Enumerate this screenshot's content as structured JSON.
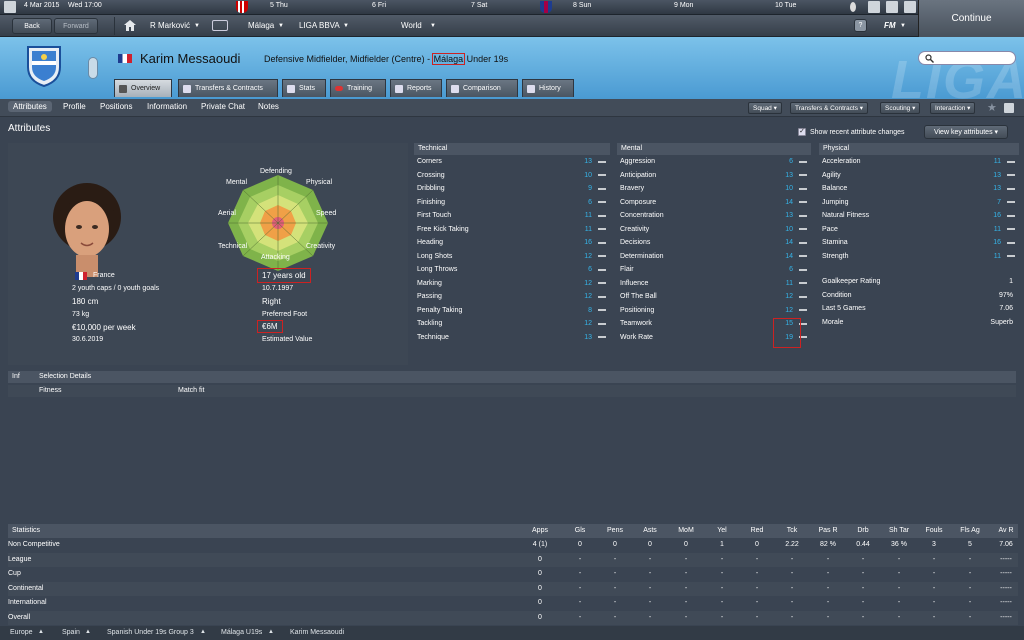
{
  "topbar": {
    "date": "4 Mar 2015",
    "daytime": "Wed 17:00",
    "calendar": [
      "5 Thu",
      "6 Fri",
      "7 Sat",
      "8 Sun",
      "9 Mon",
      "10 Tue"
    ]
  },
  "nav": {
    "back": "Back",
    "forward": "Forward",
    "manager": "R Marković",
    "club": "Málaga",
    "league": "LIGA BBVA",
    "world": "World",
    "help": "?",
    "fm": "FM",
    "continue": "Continue"
  },
  "player": {
    "name": "Karim Messaoudi",
    "description": "Defensive Midfielder, Midfielder (Centre) -",
    "club": "Málaga",
    "team": "Under 19s",
    "header_watermark": "LIGA"
  },
  "tabs": [
    "Overview",
    "Transfers & Contracts",
    "Stats",
    "Training",
    "Reports",
    "Comparison",
    "History"
  ],
  "subnav": [
    "Attributes",
    "Profile",
    "Positions",
    "Information",
    "Private Chat",
    "Notes"
  ],
  "dropdowns": [
    "Squad",
    "Transfers & Contracts",
    "Scouting",
    "Interaction"
  ],
  "section_title": "Attributes",
  "show_recent": "Show recent attribute changes",
  "view_key": "View key attributes",
  "radar": {
    "labels": [
      "Defending",
      "Physical",
      "Speed",
      "Creativity",
      "Attacking",
      "Technical",
      "Aerial",
      "Mental"
    ]
  },
  "profile": {
    "nationality": "France",
    "caps": "2 youth caps / 0 youth goals",
    "height": "180 cm",
    "weight": "73 kg",
    "wage": "€10,000 per week",
    "contract_end": "30.6.2019",
    "age": "17 years old",
    "dob": "10.7.1997",
    "foot": "Right",
    "foot_label": "Preferred Foot",
    "value": "€6M",
    "value_label": "Estimated Value"
  },
  "technical": {
    "title": "Technical",
    "attrs": [
      {
        "name": "Corners",
        "value": "13"
      },
      {
        "name": "Crossing",
        "value": "10"
      },
      {
        "name": "Dribbling",
        "value": "9"
      },
      {
        "name": "Finishing",
        "value": "6"
      },
      {
        "name": "First Touch",
        "value": "11"
      },
      {
        "name": "Free Kick Taking",
        "value": "11"
      },
      {
        "name": "Heading",
        "value": "16"
      },
      {
        "name": "Long Shots",
        "value": "12"
      },
      {
        "name": "Long Throws",
        "value": "6"
      },
      {
        "name": "Marking",
        "value": "12"
      },
      {
        "name": "Passing",
        "value": "12"
      },
      {
        "name": "Penalty Taking",
        "value": "8"
      },
      {
        "name": "Tackling",
        "value": "12"
      },
      {
        "name": "Technique",
        "value": "13"
      }
    ]
  },
  "mental": {
    "title": "Mental",
    "attrs": [
      {
        "name": "Aggression",
        "value": "6"
      },
      {
        "name": "Anticipation",
        "value": "13"
      },
      {
        "name": "Bravery",
        "value": "10"
      },
      {
        "name": "Composure",
        "value": "14"
      },
      {
        "name": "Concentration",
        "value": "13"
      },
      {
        "name": "Creativity",
        "value": "10"
      },
      {
        "name": "Decisions",
        "value": "14"
      },
      {
        "name": "Determination",
        "value": "14"
      },
      {
        "name": "Flair",
        "value": "6"
      },
      {
        "name": "Influence",
        "value": "11"
      },
      {
        "name": "Off The Ball",
        "value": "12"
      },
      {
        "name": "Positioning",
        "value": "12"
      },
      {
        "name": "Teamwork",
        "value": "15"
      },
      {
        "name": "Work Rate",
        "value": "19"
      }
    ]
  },
  "physical": {
    "title": "Physical",
    "attrs": [
      {
        "name": "Acceleration",
        "value": "11"
      },
      {
        "name": "Agility",
        "value": "13"
      },
      {
        "name": "Balance",
        "value": "13"
      },
      {
        "name": "Jumping",
        "value": "7"
      },
      {
        "name": "Natural Fitness",
        "value": "16"
      },
      {
        "name": "Pace",
        "value": "11"
      },
      {
        "name": "Stamina",
        "value": "16"
      },
      {
        "name": "Strength",
        "value": "11"
      }
    ],
    "extra": [
      {
        "name": "Goalkeeper Rating",
        "value": "1"
      },
      {
        "name": "Condition",
        "value": "97%"
      },
      {
        "name": "Last 5 Games",
        "value": "7.06"
      },
      {
        "name": "Morale",
        "value": "Superb"
      }
    ]
  },
  "selection": {
    "inf": "Inf",
    "title": "Selection Details",
    "fitness": "Fitness",
    "match_fit": "Match fit"
  },
  "stats": {
    "title": "Statistics",
    "columns": [
      "Apps",
      "Gls",
      "Pens",
      "Asts",
      "MoM",
      "Yel",
      "Red",
      "Tck",
      "Pas R",
      "Drb",
      "Sh Tar",
      "Fouls",
      "Fls Ag",
      "Av R"
    ],
    "rows": [
      {
        "label": "Non Competitive",
        "cells": [
          "4 (1)",
          "0",
          "0",
          "0",
          "0",
          "1",
          "0",
          "2.22",
          "82 %",
          "0.44",
          "36 %",
          "3",
          "5",
          "7.06"
        ]
      },
      {
        "label": "League",
        "cells": [
          "0",
          "-",
          "-",
          "-",
          "-",
          "-",
          "-",
          "-",
          "-",
          "-",
          "-",
          "-",
          "-",
          "-----"
        ]
      },
      {
        "label": "Cup",
        "cells": [
          "0",
          "-",
          "-",
          "-",
          "-",
          "-",
          "-",
          "-",
          "-",
          "-",
          "-",
          "-",
          "-",
          "-----"
        ]
      },
      {
        "label": "Continental",
        "cells": [
          "0",
          "-",
          "-",
          "-",
          "-",
          "-",
          "-",
          "-",
          "-",
          "-",
          "-",
          "-",
          "-",
          "-----"
        ]
      },
      {
        "label": "International",
        "cells": [
          "0",
          "-",
          "-",
          "-",
          "-",
          "-",
          "-",
          "-",
          "-",
          "-",
          "-",
          "-",
          "-",
          "-----"
        ]
      },
      {
        "label": "Overall",
        "cells": [
          "0",
          "-",
          "-",
          "-",
          "-",
          "-",
          "-",
          "-",
          "-",
          "-",
          "-",
          "-",
          "-",
          "-----"
        ]
      }
    ]
  },
  "breadcrumb": [
    "Europe",
    "Spain",
    "Spanish Under 19s Group 3",
    "Málaga U19s",
    "Karim Messaoudi"
  ],
  "colors": {
    "attr_value": "#35b4e8",
    "highlight": "#cc2222",
    "header_blue": "#5fb0e0"
  }
}
